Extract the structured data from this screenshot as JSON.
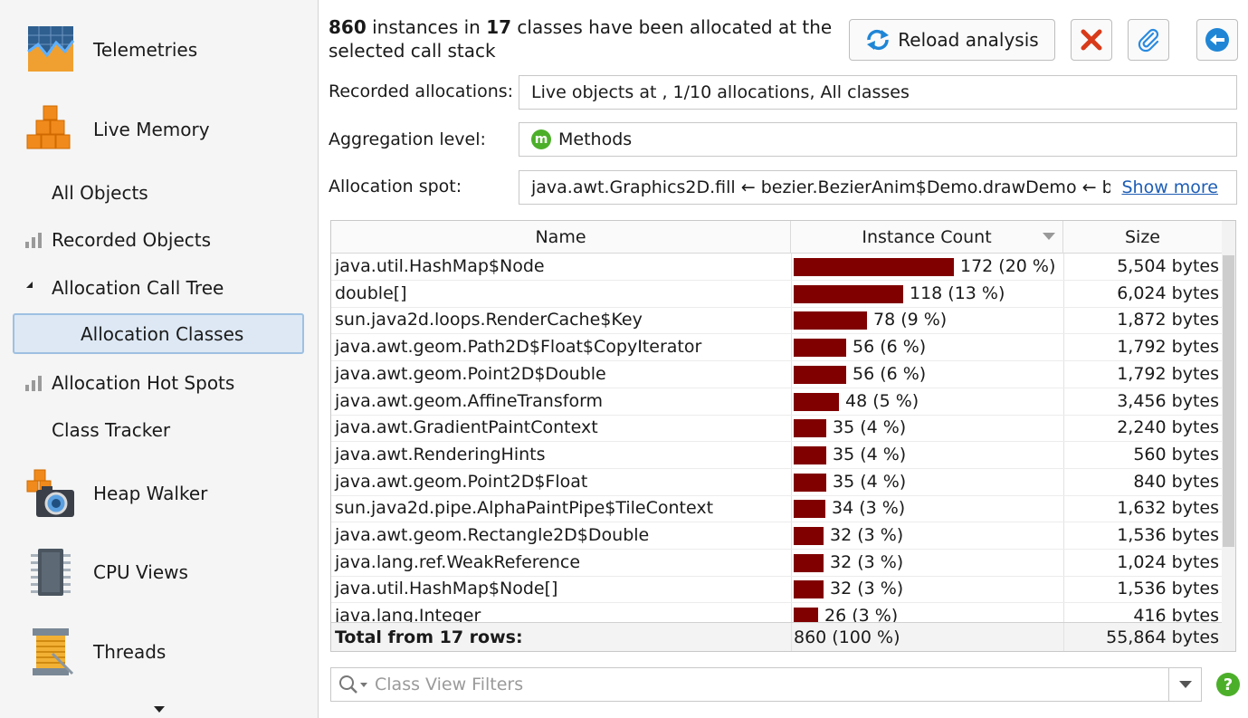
{
  "sidebar": {
    "telemetries": "Telemetries",
    "live_memory": "Live Memory",
    "all_objects": "All Objects",
    "recorded_objects": "Recorded Objects",
    "allocation_call_tree": "Allocation Call Tree",
    "allocation_classes": "Allocation Classes",
    "allocation_hot_spots": "Allocation Hot Spots",
    "class_tracker": "Class Tracker",
    "heap_walker": "Heap Walker",
    "cpu_views": "CPU Views",
    "threads": "Threads"
  },
  "header": {
    "count_instances": "860",
    "text_instances_in": " instances in ",
    "count_classes": "17",
    "text_rest": " classes have been allocated at the selected call stack",
    "reload_label": "Reload analysis"
  },
  "form": {
    "recorded_label": "Recorded allocations:",
    "recorded_value": "Live objects at  , 1/10 allocations, All classes",
    "aggregation_label": "Aggregation level:",
    "aggregation_badge": "m",
    "aggregation_value": "Methods",
    "spot_label": "Allocation spot:",
    "spot_value": "java.awt.Graphics2D.fill ← bezier.BezierAnim$Demo.drawDemo ← b",
    "show_more": "Show more"
  },
  "table": {
    "columns": [
      "Name",
      "Instance Count",
      "Size"
    ],
    "rows": [
      {
        "name": "java.util.HashMap$Node",
        "count": "172 (20 %)",
        "fraction": 0.2,
        "size": "5,504 bytes"
      },
      {
        "name": "double[]",
        "count": "118 (13 %)",
        "fraction": 0.137,
        "size": "6,024 bytes"
      },
      {
        "name": "sun.java2d.loops.RenderCache$Key",
        "count": "78 (9 %)",
        "fraction": 0.091,
        "size": "1,872 bytes"
      },
      {
        "name": "java.awt.geom.Path2D$Float$CopyIterator",
        "count": "56 (6 %)",
        "fraction": 0.065,
        "size": "1,792 bytes"
      },
      {
        "name": "java.awt.geom.Point2D$Double",
        "count": "56 (6 %)",
        "fraction": 0.065,
        "size": "1,792 bytes"
      },
      {
        "name": "java.awt.geom.AffineTransform",
        "count": "48 (5 %)",
        "fraction": 0.056,
        "size": "3,456 bytes"
      },
      {
        "name": "java.awt.GradientPaintContext",
        "count": "35 (4 %)",
        "fraction": 0.041,
        "size": "2,240 bytes"
      },
      {
        "name": "java.awt.RenderingHints",
        "count": "35 (4 %)",
        "fraction": 0.041,
        "size": "560 bytes"
      },
      {
        "name": "java.awt.geom.Point2D$Float",
        "count": "35 (4 %)",
        "fraction": 0.041,
        "size": "840 bytes"
      },
      {
        "name": "sun.java2d.pipe.AlphaPaintPipe$TileContext",
        "count": "34 (3 %)",
        "fraction": 0.04,
        "size": "1,632 bytes"
      },
      {
        "name": "java.awt.geom.Rectangle2D$Double",
        "count": "32 (3 %)",
        "fraction": 0.037,
        "size": "1,536 bytes"
      },
      {
        "name": "java.lang.ref.WeakReference",
        "count": "32 (3 %)",
        "fraction": 0.037,
        "size": "1,024 bytes"
      },
      {
        "name": "java.util.HashMap$Node[]",
        "count": "32 (3 %)",
        "fraction": 0.037,
        "size": "1,536 bytes"
      },
      {
        "name": "java.lang.Integer",
        "count": "26 (3 %)",
        "fraction": 0.03,
        "size": "416 bytes"
      }
    ],
    "total_label": "Total from 17 rows:",
    "total_count": "860 (100 %)",
    "total_size": "55,864 bytes"
  },
  "filter": {
    "placeholder": "Class View Filters"
  },
  "help": "?",
  "colors": {
    "bar": "#800000",
    "selection": "#dde8f4",
    "link": "#1d5db5"
  }
}
